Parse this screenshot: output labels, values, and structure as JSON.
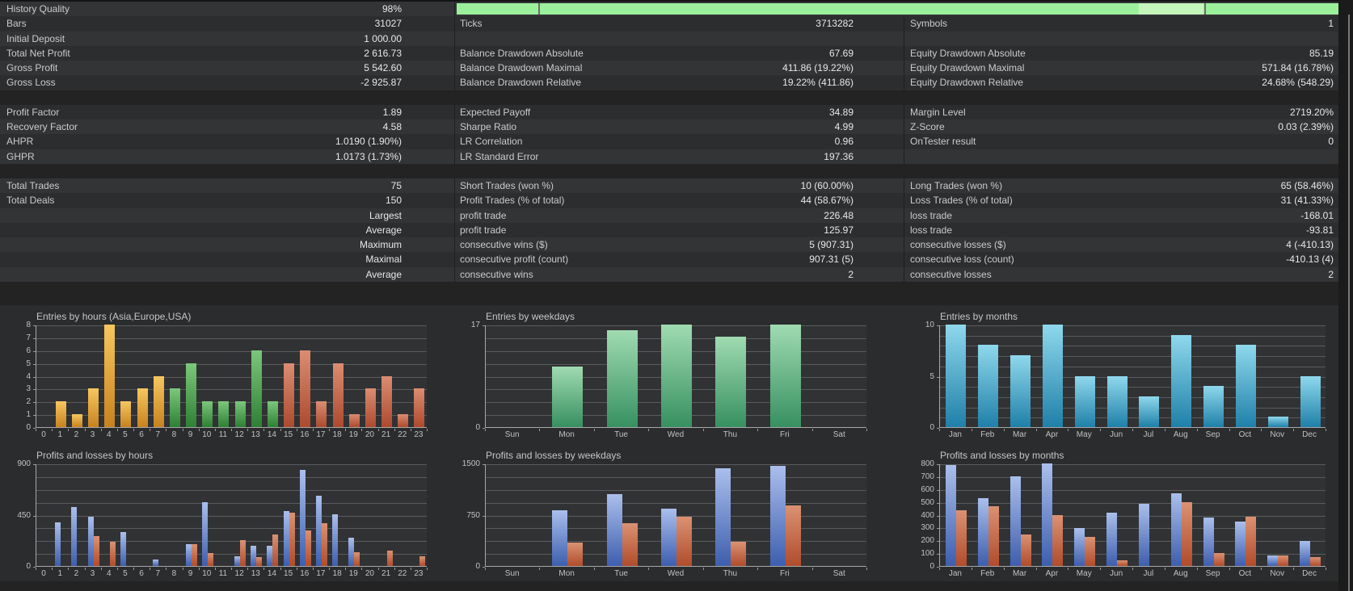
{
  "window": {
    "bg": "#232323"
  },
  "stats_table": {
    "quality_bar": {
      "color": "#9CF09C",
      "pale_color": "#C4F6BB",
      "pale_from": 0.773,
      "pale_to": 0.846,
      "slits": [
        0.0925,
        0.847
      ]
    },
    "rows": [
      {
        "bar": true,
        "cells": [
          [
            "History Quality",
            "98%"
          ]
        ]
      },
      {
        "cells": [
          [
            "Bars",
            "31027"
          ],
          [
            "Ticks",
            "3713282"
          ],
          [
            "Symbols",
            "1"
          ]
        ]
      },
      {
        "cells": [
          [
            "Initial Deposit",
            "1 000.00"
          ],
          [
            "",
            ""
          ],
          [
            "",
            ""
          ]
        ]
      },
      {
        "cells": [
          [
            "Total Net Profit",
            "2 616.73"
          ],
          [
            "Balance Drawdown Absolute",
            "67.69"
          ],
          [
            "Equity Drawdown Absolute",
            "85.19"
          ]
        ]
      },
      {
        "cells": [
          [
            "Gross Profit",
            "5 542.60"
          ],
          [
            "Balance Drawdown Maximal",
            "411.86 (19.22%)"
          ],
          [
            "Equity Drawdown Maximal",
            "571.84 (16.78%)"
          ]
        ]
      },
      {
        "cells": [
          [
            "Gross Loss",
            "-2 925.87"
          ],
          [
            "Balance Drawdown Relative",
            "19.22% (411.86)"
          ],
          [
            "Equity Drawdown Relative",
            "24.68% (548.29)"
          ]
        ]
      },
      {
        "blank": true
      },
      {
        "cells": [
          [
            "Profit Factor",
            "1.89"
          ],
          [
            "Expected Payoff",
            "34.89"
          ],
          [
            "Margin Level",
            "2719.20%"
          ]
        ]
      },
      {
        "cells": [
          [
            "Recovery Factor",
            "4.58"
          ],
          [
            "Sharpe Ratio",
            "4.99"
          ],
          [
            "Z-Score",
            "0.03 (2.39%)"
          ]
        ]
      },
      {
        "cells": [
          [
            "AHPR",
            "1.0190 (1.90%)"
          ],
          [
            "LR Correlation",
            "0.96"
          ],
          [
            "OnTester result",
            "0"
          ]
        ]
      },
      {
        "cells": [
          [
            "GHPR",
            "1.0173 (1.73%)"
          ],
          [
            "LR Standard Error",
            "197.36"
          ],
          [
            "",
            ""
          ]
        ]
      },
      {
        "blank": true
      },
      {
        "cells": [
          [
            "Total Trades",
            "75"
          ],
          [
            "Short Trades (won %)",
            "10 (60.00%)"
          ],
          [
            "Long Trades (won %)",
            "65 (58.46%)"
          ]
        ]
      },
      {
        "cells": [
          [
            "Total Deals",
            "150"
          ],
          [
            "Profit Trades (% of total)",
            "44 (58.67%)"
          ],
          [
            "Loss Trades (% of total)",
            "31 (41.33%)"
          ]
        ]
      },
      {
        "cells": [
          [
            "",
            "Largest"
          ],
          [
            "profit trade",
            "226.48"
          ],
          [
            "loss trade",
            "-168.01"
          ]
        ]
      },
      {
        "cells": [
          [
            "",
            "Average"
          ],
          [
            "profit trade",
            "125.97"
          ],
          [
            "loss trade",
            "-93.81"
          ]
        ]
      },
      {
        "cells": [
          [
            "",
            "Maximum"
          ],
          [
            "consecutive wins ($)",
            "5 (907.31)"
          ],
          [
            "consecutive losses ($)",
            "4 (-410.13)"
          ]
        ]
      },
      {
        "cells": [
          [
            "",
            "Maximal"
          ],
          [
            "consecutive profit (count)",
            "907.31 (5)"
          ],
          [
            "consecutive loss (count)",
            "-410.13 (4)"
          ]
        ]
      },
      {
        "cells": [
          [
            "",
            "Average"
          ],
          [
            "consecutive wins",
            "2"
          ],
          [
            "consecutive losses",
            "2"
          ]
        ]
      }
    ]
  },
  "chart_data": [
    {
      "id": "entries_by_hours",
      "type": "bar",
      "title": "Entries by hours (Asia,Europe,USA)",
      "categories": [
        "0",
        "1",
        "2",
        "3",
        "4",
        "5",
        "6",
        "7",
        "8",
        "9",
        "10",
        "11",
        "12",
        "13",
        "14",
        "15",
        "16",
        "17",
        "18",
        "19",
        "20",
        "21",
        "22",
        "23"
      ],
      "values": [
        0,
        2,
        1,
        3,
        8,
        2,
        3,
        4,
        3,
        5,
        2,
        2,
        2,
        6,
        2,
        5,
        6,
        2,
        5,
        1,
        3,
        4,
        1,
        3
      ],
      "ylim": [
        0,
        8
      ],
      "yticks": [
        8,
        7,
        6,
        5,
        4,
        3,
        2,
        1,
        0
      ],
      "grid_divisions": 8,
      "sessions": [
        {
          "name": "Asia",
          "from": 0,
          "to": 7,
          "color_top": "#F6C75F",
          "color_bottom": "#C8821E"
        },
        {
          "name": "Europe",
          "from": 8,
          "to": 14,
          "color_top": "#7CC77C",
          "color_bottom": "#2E8034"
        },
        {
          "name": "USA",
          "from": 15,
          "to": 23,
          "color_top": "#DA8D72",
          "color_bottom": "#AD4A2E"
        }
      ]
    },
    {
      "id": "entries_by_weekdays",
      "type": "bar",
      "title": "Entries by weekdays",
      "categories": [
        "Sun",
        "Mon",
        "Tue",
        "Wed",
        "Thu",
        "Fri",
        "Sat"
      ],
      "values": [
        0,
        10,
        16,
        17,
        15,
        17,
        0
      ],
      "ylim": [
        0,
        17
      ],
      "yticks": [
        17,
        0
      ],
      "grid_divisions": 8,
      "color_top": "#A0DBB1",
      "color_bottom": "#379061"
    },
    {
      "id": "entries_by_months",
      "type": "bar",
      "title": "Entries by months",
      "categories": [
        "Jan",
        "Feb",
        "Mar",
        "Apr",
        "May",
        "Jun",
        "Jul",
        "Aug",
        "Sep",
        "Oct",
        "Nov",
        "Dec"
      ],
      "values": [
        10,
        8,
        7,
        10,
        5,
        5,
        3,
        9,
        4,
        8,
        1,
        5
      ],
      "ylim": [
        0,
        10
      ],
      "yticks": [
        10,
        5,
        0
      ],
      "grid_divisions": 10,
      "color_top": "#8FD8EC",
      "color_bottom": "#1F80A8"
    },
    {
      "id": "pl_by_hours",
      "type": "bar",
      "title": "Profits and losses by hours",
      "categories": [
        "0",
        "1",
        "2",
        "3",
        "4",
        "5",
        "6",
        "7",
        "8",
        "9",
        "10",
        "11",
        "12",
        "13",
        "14",
        "15",
        "16",
        "17",
        "18",
        "19",
        "20",
        "21",
        "22",
        "23"
      ],
      "series": [
        {
          "name": "profit",
          "values": [
            0,
            380,
            520,
            430,
            0,
            300,
            0,
            60,
            0,
            190,
            560,
            0,
            85,
            180,
            180,
            480,
            840,
            620,
            455,
            245,
            0,
            0,
            0,
            0
          ],
          "color_top": "#AABFEC",
          "color_bottom": "#3D5EAE"
        },
        {
          "name": "loss",
          "values": [
            0,
            0,
            0,
            265,
            215,
            0,
            0,
            0,
            0,
            190,
            115,
            0,
            225,
            80,
            280,
            470,
            310,
            375,
            0,
            120,
            0,
            135,
            0,
            85
          ],
          "color_top": "#DA9273",
          "color_bottom": "#B04C2B"
        }
      ],
      "ylim": [
        0,
        900
      ],
      "yticks": [
        900,
        450,
        0
      ],
      "grid_divisions": 8
    },
    {
      "id": "pl_by_weekdays",
      "type": "bar",
      "title": "Profits and losses by weekdays",
      "categories": [
        "Sun",
        "Mon",
        "Tue",
        "Wed",
        "Thu",
        "Fri",
        "Sat"
      ],
      "series": [
        {
          "name": "profit",
          "values": [
            0,
            820,
            1050,
            840,
            1430,
            1465,
            0
          ],
          "color_top": "#AABFEC",
          "color_bottom": "#3D5EAE"
        },
        {
          "name": "loss",
          "values": [
            0,
            340,
            630,
            720,
            350,
            885,
            0
          ],
          "color_top": "#DA9273",
          "color_bottom": "#B04C2B"
        }
      ],
      "ylim": [
        0,
        1500
      ],
      "yticks": [
        1500,
        750,
        0
      ],
      "grid_divisions": 8
    },
    {
      "id": "pl_by_months",
      "type": "bar",
      "title": "Profits and losses by months",
      "categories": [
        "Jan",
        "Feb",
        "Mar",
        "Apr",
        "May",
        "Jun",
        "Jul",
        "Aug",
        "Sep",
        "Oct",
        "Nov",
        "Dec"
      ],
      "series": [
        {
          "name": "profit",
          "values": [
            790,
            530,
            700,
            800,
            295,
            415,
            485,
            565,
            375,
            345,
            85,
            195
          ],
          "color_top": "#AABFEC",
          "color_bottom": "#3D5EAE"
        },
        {
          "name": "loss",
          "values": [
            435,
            465,
            245,
            395,
            225,
            45,
            0,
            500,
            100,
            385,
            85,
            70
          ],
          "color_top": "#DA9273",
          "color_bottom": "#B04C2B"
        }
      ],
      "ylim": [
        0,
        800
      ],
      "yticks": [
        800,
        700,
        600,
        500,
        400,
        300,
        200,
        100,
        0
      ],
      "grid_divisions": 8
    }
  ]
}
